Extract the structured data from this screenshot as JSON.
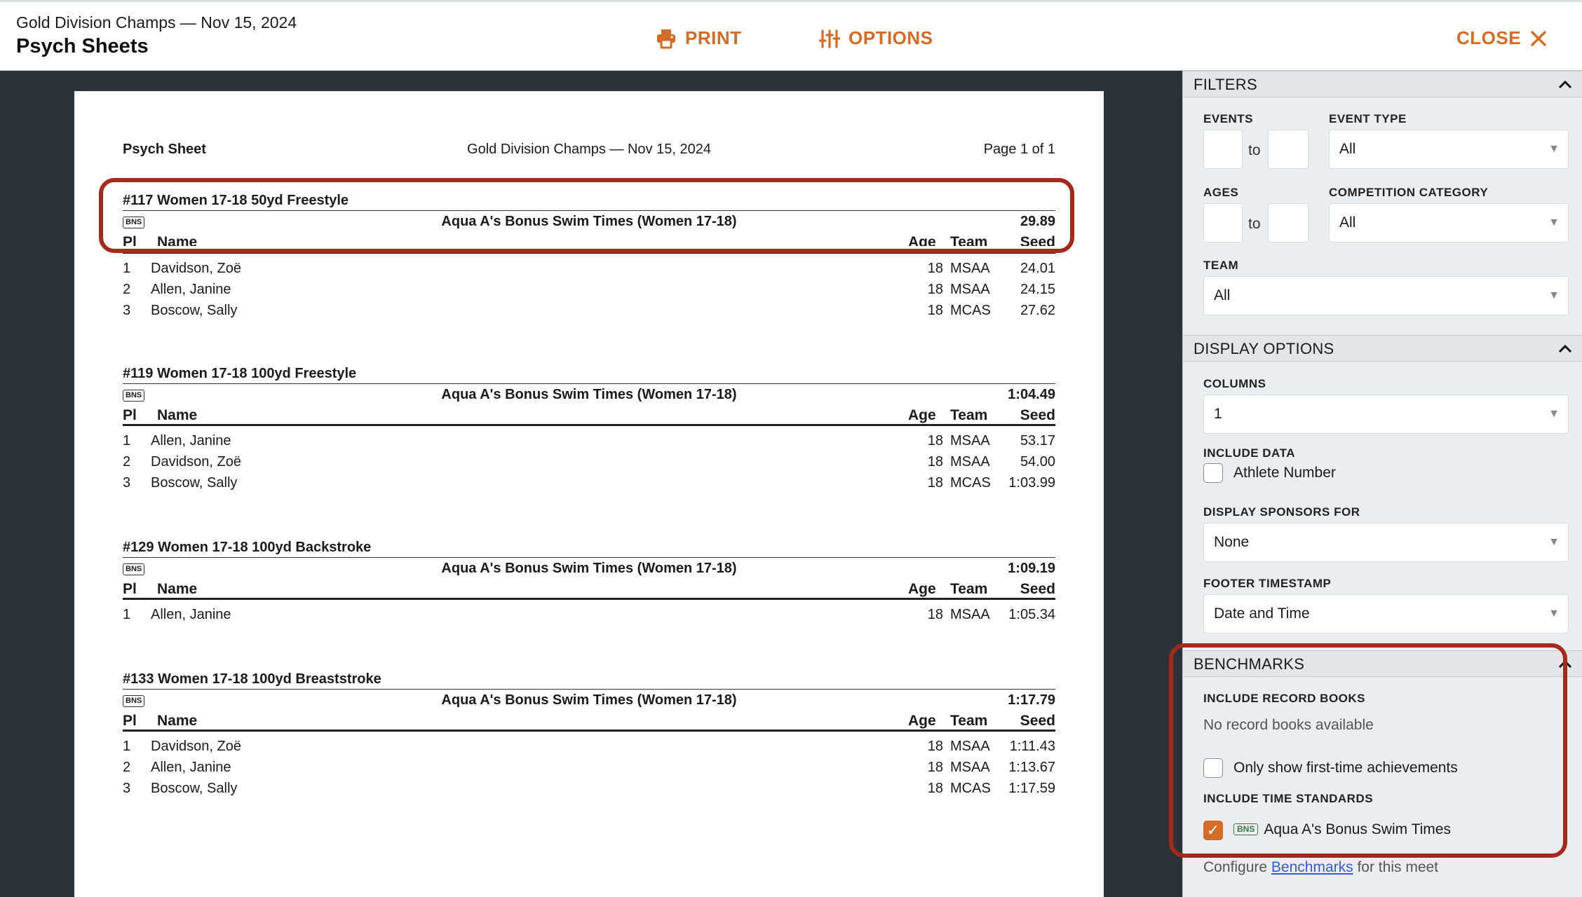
{
  "header": {
    "meet_subtitle": "Gold Division Champs — Nov 15, 2024",
    "title": "Psych Sheets",
    "print_label": "PRINT",
    "options_label": "OPTIONS",
    "close_label": "CLOSE",
    "accent_color": "#d46c23"
  },
  "document": {
    "left_title": "Psych Sheet",
    "center_title": "Gold Division Champs — Nov 15, 2024",
    "page_label": "Page 1 of 1",
    "col_pl": "Pl",
    "col_name": "Name",
    "col_age": "Age",
    "col_team": "Team",
    "col_seed": "Seed",
    "events": [
      {
        "title": "#117 Women 17-18 50yd Freestyle",
        "std_tag": "BNS",
        "std_name": "Aqua A's Bonus Swim Times (Women 17-18)",
        "std_time": "29.89",
        "rows": [
          {
            "pl": "1",
            "name": "Davidson, Zoë",
            "age": "18",
            "team": "MSAA",
            "seed": "24.01"
          },
          {
            "pl": "2",
            "name": "Allen, Janine",
            "age": "18",
            "team": "MSAA",
            "seed": "24.15"
          },
          {
            "pl": "3",
            "name": "Boscow, Sally",
            "age": "18",
            "team": "MCAS",
            "seed": "27.62"
          }
        ]
      },
      {
        "title": "#119 Women 17-18 100yd Freestyle",
        "std_tag": "BNS",
        "std_name": "Aqua A's Bonus Swim Times (Women 17-18)",
        "std_time": "1:04.49",
        "rows": [
          {
            "pl": "1",
            "name": "Allen, Janine",
            "age": "18",
            "team": "MSAA",
            "seed": "53.17"
          },
          {
            "pl": "2",
            "name": "Davidson, Zoë",
            "age": "18",
            "team": "MSAA",
            "seed": "54.00"
          },
          {
            "pl": "3",
            "name": "Boscow, Sally",
            "age": "18",
            "team": "MCAS",
            "seed": "1:03.99"
          }
        ]
      },
      {
        "title": "#129 Women 17-18 100yd Backstroke",
        "std_tag": "BNS",
        "std_name": "Aqua A's Bonus Swim Times (Women 17-18)",
        "std_time": "1:09.19",
        "rows": [
          {
            "pl": "1",
            "name": "Allen, Janine",
            "age": "18",
            "team": "MSAA",
            "seed": "1:05.34"
          }
        ]
      },
      {
        "title": "#133 Women 17-18 100yd Breaststroke",
        "std_tag": "BNS",
        "std_name": "Aqua A's Bonus Swim Times (Women 17-18)",
        "std_time": "1:17.79",
        "rows": [
          {
            "pl": "1",
            "name": "Davidson, Zoë",
            "age": "18",
            "team": "MSAA",
            "seed": "1:11.43"
          },
          {
            "pl": "2",
            "name": "Allen, Janine",
            "age": "18",
            "team": "MSAA",
            "seed": "1:13.67"
          },
          {
            "pl": "3",
            "name": "Boscow, Sally",
            "age": "18",
            "team": "MCAS",
            "seed": "1:17.59"
          }
        ]
      }
    ]
  },
  "panel": {
    "filters": {
      "header": "FILTERS",
      "events_label": "EVENTS",
      "to_label": "to",
      "event_type_label": "EVENT TYPE",
      "event_type_value": "All",
      "ages_label": "AGES",
      "competition_category_label": "COMPETITION CATEGORY",
      "competition_category_value": "All",
      "team_label": "TEAM",
      "team_value": "All"
    },
    "display": {
      "header": "DISPLAY OPTIONS",
      "columns_label": "COLUMNS",
      "columns_value": "1",
      "include_data_label": "INCLUDE DATA",
      "athlete_number_label": "Athlete Number",
      "athlete_number_checked": false,
      "sponsors_label": "DISPLAY SPONSORS FOR",
      "sponsors_value": "None",
      "footer_label": "FOOTER TIMESTAMP",
      "footer_value": "Date and Time"
    },
    "benchmarks": {
      "header": "BENCHMARKS",
      "record_books_label": "INCLUDE RECORD BOOKS",
      "record_books_empty": "No record books available",
      "first_time_label": "Only show first-time achievements",
      "first_time_checked": false,
      "time_standards_label": "INCLUDE TIME STANDARDS",
      "standard_tag": "BNS",
      "standard_name": "Aqua A's Bonus Swim Times",
      "standard_checked": true,
      "configure_prefix": "Configure",
      "configure_link": "Benchmarks",
      "configure_suffix": "for this meet"
    }
  }
}
